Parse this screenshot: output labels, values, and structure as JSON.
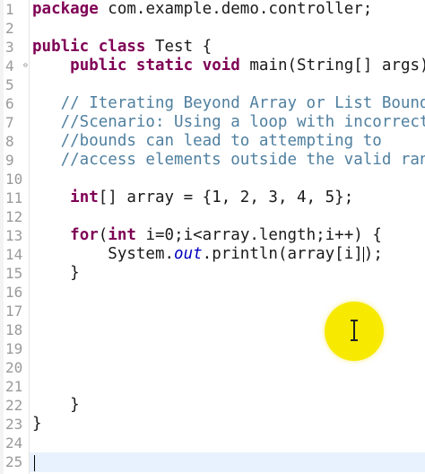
{
  "editor": {
    "lines": [
      {
        "num": "1",
        "tokens": [
          {
            "t": "kw",
            "s": "package"
          },
          {
            "t": "",
            "s": " com.example.demo.controller;"
          }
        ]
      },
      {
        "num": "2",
        "tokens": []
      },
      {
        "num": "3",
        "tokens": [
          {
            "t": "kw",
            "s": "public"
          },
          {
            "t": "",
            "s": " "
          },
          {
            "t": "kw",
            "s": "class"
          },
          {
            "t": "",
            "s": " Test {"
          }
        ]
      },
      {
        "num": "4",
        "fold": "⊖",
        "tokens": [
          {
            "t": "",
            "s": "    "
          },
          {
            "t": "kw",
            "s": "public"
          },
          {
            "t": "",
            "s": " "
          },
          {
            "t": "kw",
            "s": "static"
          },
          {
            "t": "",
            "s": " "
          },
          {
            "t": "kw",
            "s": "void"
          },
          {
            "t": "",
            "s": " main(String[] args)"
          }
        ]
      },
      {
        "num": "5",
        "tokens": []
      },
      {
        "num": "6",
        "tokens": [
          {
            "t": "",
            "s": "   "
          },
          {
            "t": "cm",
            "s": "// Iterating Beyond Array or List Bounds"
          }
        ]
      },
      {
        "num": "7",
        "tokens": [
          {
            "t": "",
            "s": "   "
          },
          {
            "t": "cm",
            "s": "//Scenario: Using a loop with incorrect"
          }
        ]
      },
      {
        "num": "8",
        "tokens": [
          {
            "t": "",
            "s": "   "
          },
          {
            "t": "cm",
            "s": "//bounds can lead to attempting to"
          }
        ]
      },
      {
        "num": "9",
        "tokens": [
          {
            "t": "",
            "s": "   "
          },
          {
            "t": "cm",
            "s": "//access elements outside the valid range"
          }
        ]
      },
      {
        "num": "10",
        "tokens": []
      },
      {
        "num": "11",
        "tokens": [
          {
            "t": "",
            "s": "    "
          },
          {
            "t": "kw",
            "s": "int"
          },
          {
            "t": "",
            "s": "[] array = {1, 2, 3, 4, 5};"
          }
        ]
      },
      {
        "num": "12",
        "tokens": []
      },
      {
        "num": "13",
        "tokens": [
          {
            "t": "",
            "s": "    "
          },
          {
            "t": "kw",
            "s": "for"
          },
          {
            "t": "",
            "s": "("
          },
          {
            "t": "kw",
            "s": "int"
          },
          {
            "t": "",
            "s": " i=0;i<array.length;i++) {"
          }
        ]
      },
      {
        "num": "14",
        "tokens": [
          {
            "t": "",
            "s": "        System."
          },
          {
            "t": "fd",
            "s": "out"
          },
          {
            "t": "",
            "s": ".println(array[i]"
          },
          {
            "t": "caret",
            "s": ""
          },
          {
            "t": "",
            "s": ");"
          }
        ]
      },
      {
        "num": "15",
        "tokens": [
          {
            "t": "",
            "s": "    }"
          }
        ]
      },
      {
        "num": "16",
        "tokens": []
      },
      {
        "num": "17",
        "tokens": []
      },
      {
        "num": "18",
        "tokens": []
      },
      {
        "num": "19",
        "tokens": []
      },
      {
        "num": "20",
        "tokens": []
      },
      {
        "num": "21",
        "tokens": []
      },
      {
        "num": "22",
        "tokens": [
          {
            "t": "",
            "s": "    }"
          }
        ]
      },
      {
        "num": "23",
        "tokens": [
          {
            "t": "",
            "s": "}"
          }
        ]
      },
      {
        "num": "24",
        "tokens": []
      },
      {
        "num": "25",
        "tokens": []
      }
    ]
  },
  "colors": {
    "keyword": "#7f0055",
    "comment": "#4f7f9f",
    "static_field": "#0000c0",
    "current_line": "#e8f2fe",
    "cursor_highlight": "#f7ea00"
  },
  "cursor": {
    "icon": "text-ibeam-cursor-icon"
  }
}
